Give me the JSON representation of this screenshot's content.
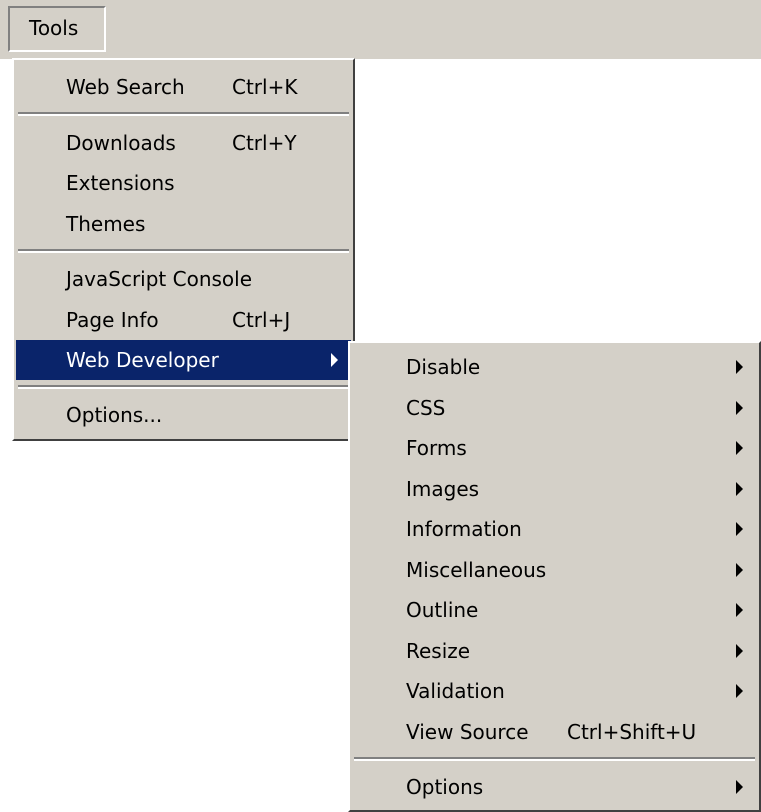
{
  "menubar": {
    "tools": "Tools"
  },
  "tools_menu": {
    "web_search": {
      "label": "Web Search",
      "shortcut": "Ctrl+K"
    },
    "downloads": {
      "label": "Downloads",
      "shortcut": "Ctrl+Y"
    },
    "extensions": {
      "label": "Extensions"
    },
    "themes": {
      "label": "Themes"
    },
    "javascript_console": {
      "label": "JavaScript Console"
    },
    "page_info": {
      "label": "Page Info",
      "shortcut": "Ctrl+J"
    },
    "web_developer": {
      "label": "Web Developer"
    },
    "options": {
      "label": "Options..."
    }
  },
  "web_developer_menu": {
    "disable": {
      "label": "Disable"
    },
    "css": {
      "label": "CSS"
    },
    "forms": {
      "label": "Forms"
    },
    "images": {
      "label": "Images"
    },
    "information": {
      "label": "Information"
    },
    "miscellaneous": {
      "label": "Miscellaneous"
    },
    "outline": {
      "label": "Outline"
    },
    "resize": {
      "label": "Resize"
    },
    "validation": {
      "label": "Validation"
    },
    "view_source": {
      "label": "View Source",
      "shortcut": "Ctrl+Shift+U"
    },
    "options": {
      "label": "Options"
    }
  },
  "colors": {
    "menu_background": "#d4d0c8",
    "highlight_background": "#0a246a",
    "highlight_text": "#ffffff"
  }
}
